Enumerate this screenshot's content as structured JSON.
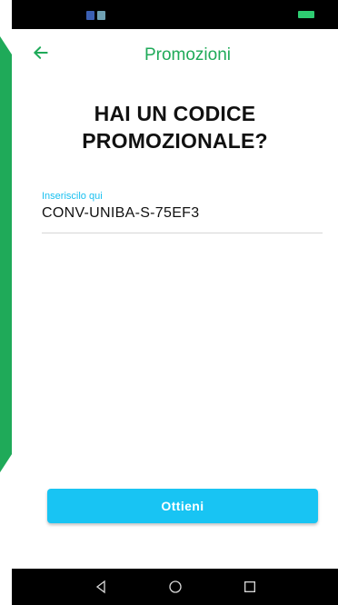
{
  "colors": {
    "brand_green": "#1faa59",
    "accent_blue": "#18c4f3"
  },
  "app_bar": {
    "title": "Promozioni",
    "back_icon": "arrow-left-icon"
  },
  "headline": {
    "line1": "HAI UN CODICE",
    "line2": "PROMOZIONALE?"
  },
  "promo_field": {
    "label": "Inseriscilo qui",
    "value": "CONV-UNIBA-S-75EF3"
  },
  "actions": {
    "obtain_label": "Ottieni"
  },
  "system_nav": {
    "back_icon": "nav-back-icon",
    "home_icon": "nav-home-icon",
    "recents_icon": "nav-recents-icon"
  }
}
